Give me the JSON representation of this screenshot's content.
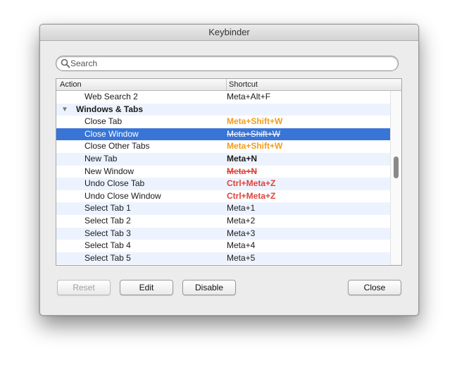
{
  "window": {
    "title": "Keybinder"
  },
  "search": {
    "placeholder": "Search",
    "value": ""
  },
  "table": {
    "columns": {
      "action": "Action",
      "shortcut": "Shortcut"
    },
    "rows": [
      {
        "action": "Web Search 2",
        "shortcut": "Meta+Alt+F",
        "style": "normal"
      },
      {
        "action": "Windows & Tabs",
        "shortcut": "",
        "style": "group"
      },
      {
        "action": "Close Tab",
        "shortcut": "Meta+Shift+W",
        "style": "orange"
      },
      {
        "action": "Close Window",
        "shortcut": "Meta+Shift+W",
        "style": "strike",
        "selected": true
      },
      {
        "action": "Close Other Tabs",
        "shortcut": "Meta+Shift+W",
        "style": "orange"
      },
      {
        "action": "New Tab",
        "shortcut": "Meta+N",
        "style": "bold"
      },
      {
        "action": "New Window",
        "shortcut": "Meta+N",
        "style": "red-strike"
      },
      {
        "action": "Undo Close Tab",
        "shortcut": "Ctrl+Meta+Z",
        "style": "red"
      },
      {
        "action": "Undo Close Window",
        "shortcut": "Ctrl+Meta+Z",
        "style": "red"
      },
      {
        "action": "Select Tab 1",
        "shortcut": "Meta+1",
        "style": "normal"
      },
      {
        "action": "Select Tab 2",
        "shortcut": "Meta+2",
        "style": "normal"
      },
      {
        "action": "Select Tab 3",
        "shortcut": "Meta+3",
        "style": "normal"
      },
      {
        "action": "Select Tab 4",
        "shortcut": "Meta+4",
        "style": "normal"
      },
      {
        "action": "Select Tab 5",
        "shortcut": "Meta+5",
        "style": "normal"
      }
    ]
  },
  "buttons": {
    "reset": "Reset",
    "edit": "Edit",
    "disable": "Disable",
    "close": "Close"
  },
  "colors": {
    "selection": "#3875d7",
    "conflict_orange": "#f39c1b",
    "conflict_red": "#e0433a",
    "alt_row": "#edf3fe"
  }
}
